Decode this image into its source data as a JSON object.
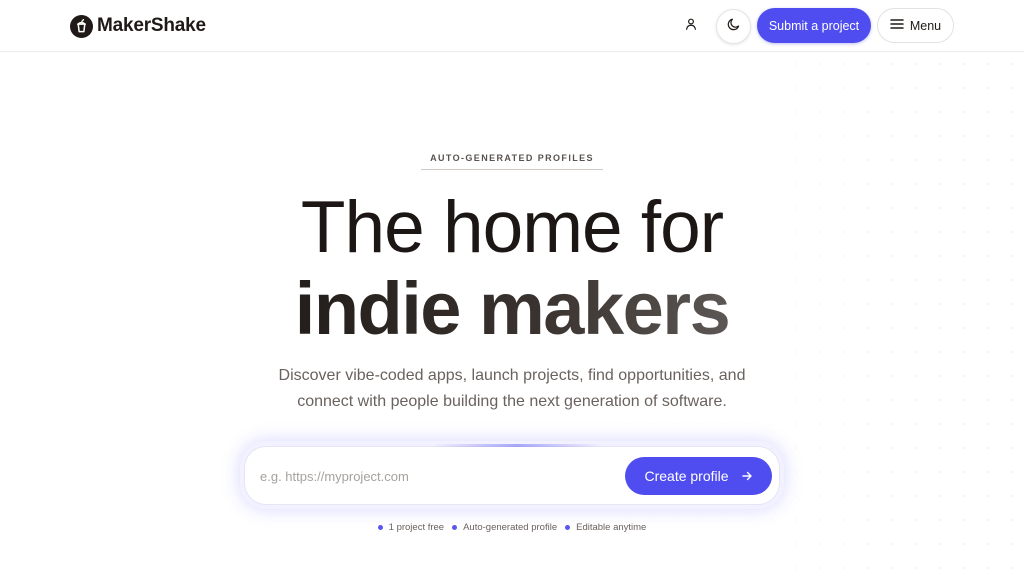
{
  "header": {
    "logo_text": "MakerShake",
    "logo_icon": "milkshake-cup-icon",
    "user_icon": "user-icon",
    "theme_icon": "moon-icon",
    "submit_label": "Submit a project",
    "menu_label": "Menu",
    "menu_icon": "hamburger-icon"
  },
  "hero": {
    "eyebrow": "AUTO-GENERATED PROFILES",
    "title_line1": "The home for",
    "title_line2": "indie makers",
    "subtitle": "Discover vibe-coded apps, launch projects, find opportunities, and connect with people building the next generation of software."
  },
  "signup": {
    "input_placeholder": "e.g. https://myproject.com",
    "input_value": "",
    "button_label": "Create profile",
    "button_icon": "arrow-right-icon"
  },
  "features": [
    {
      "label": "1 project free"
    },
    {
      "label": "Auto-generated profile"
    },
    {
      "label": "Editable anytime"
    }
  ],
  "colors": {
    "accent": "#4f4df0",
    "text_dark": "#1c1714",
    "text_muted": "#6a625e"
  }
}
